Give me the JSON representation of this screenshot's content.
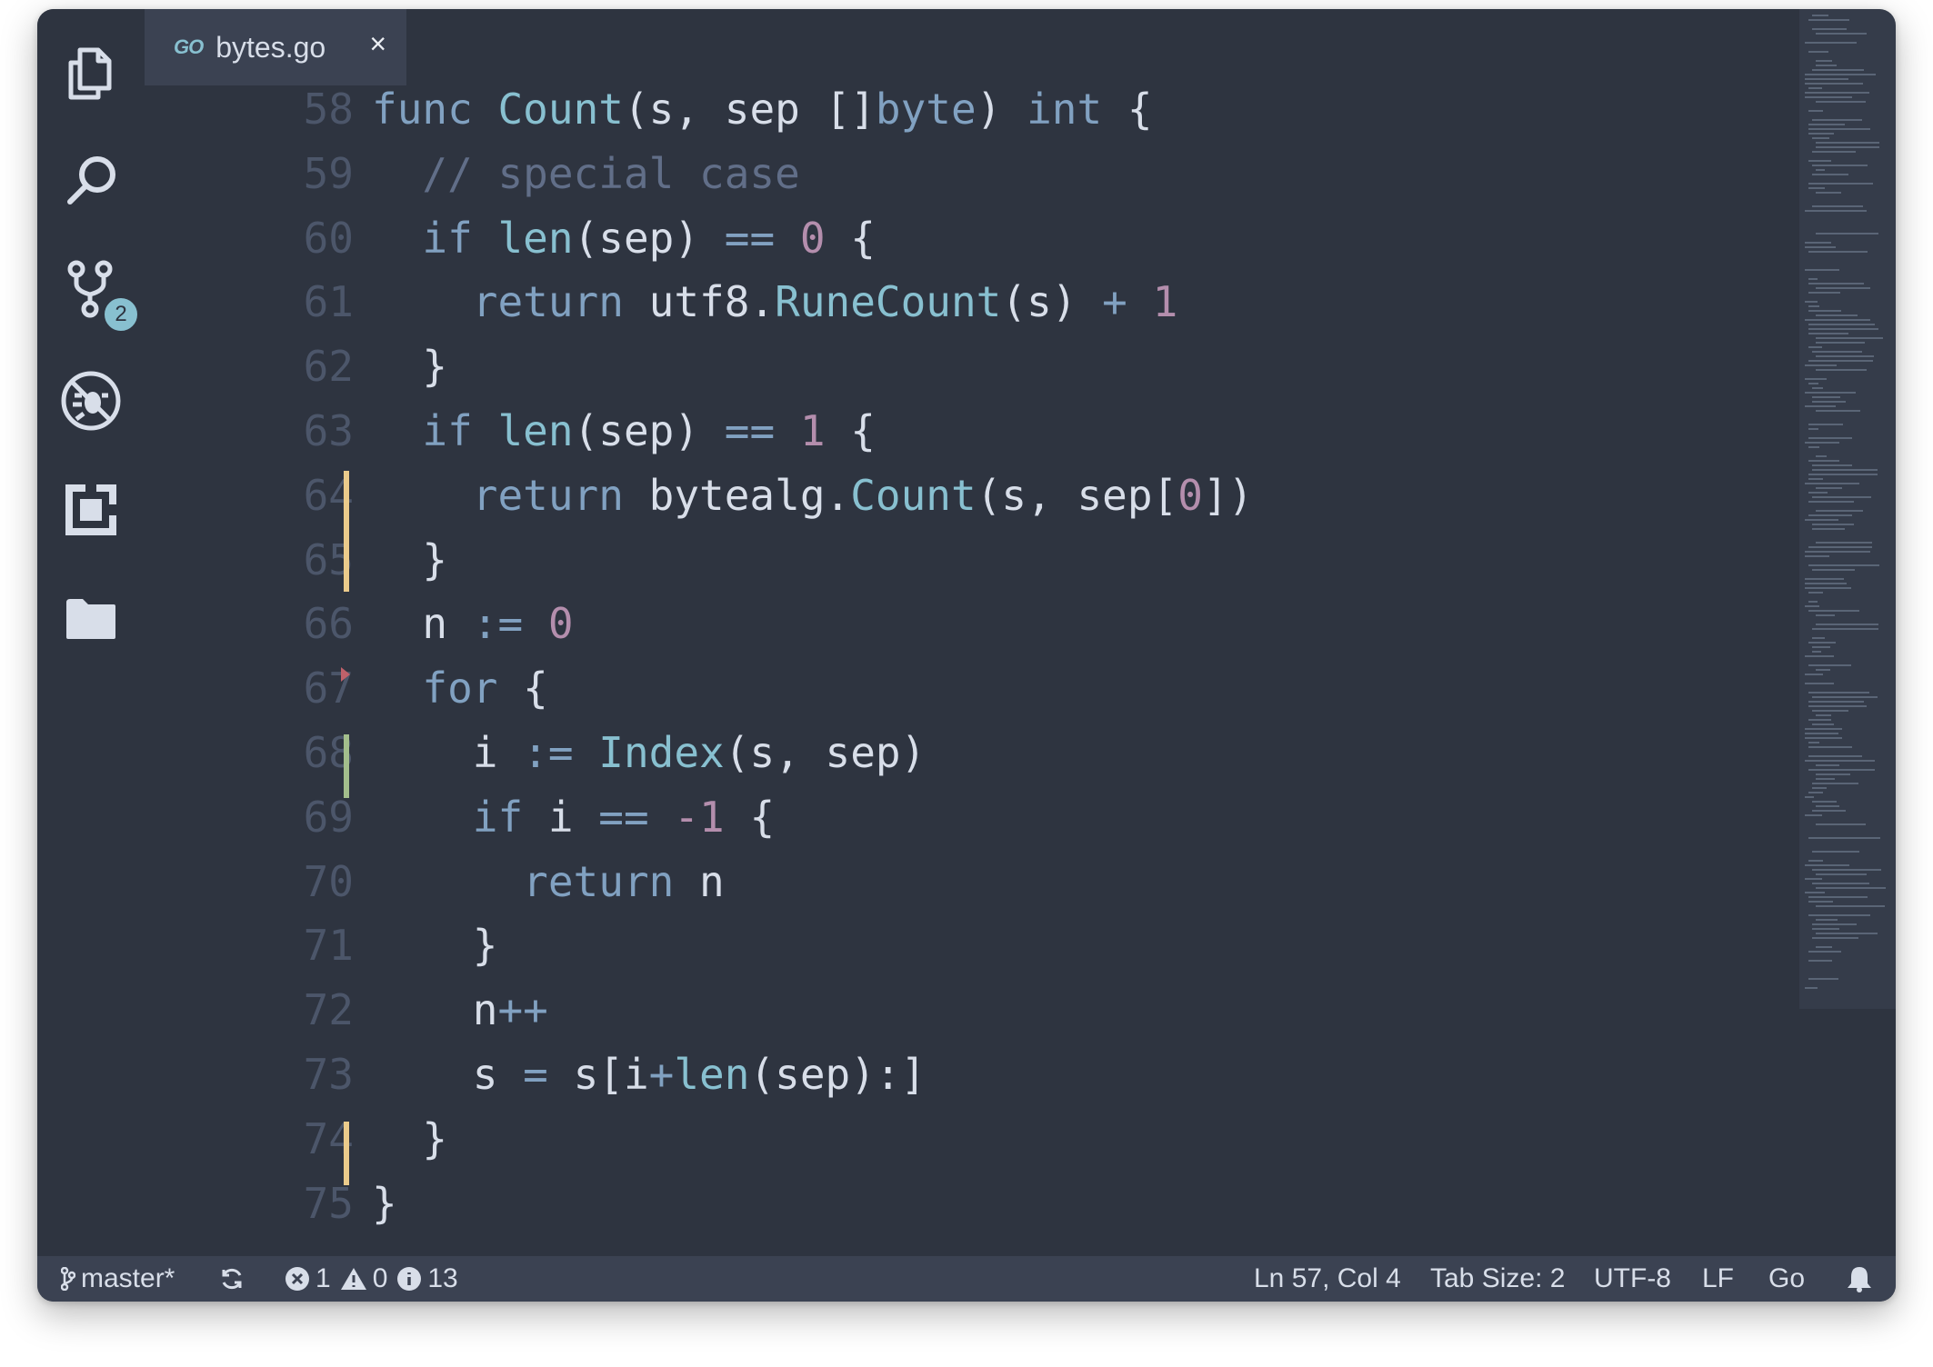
{
  "tab": {
    "icon_text": "GO",
    "filename": "bytes.go",
    "close_glyph": "×"
  },
  "activity_bar": {
    "scm_badge": "2"
  },
  "editor": {
    "lines": [
      {
        "num": "58",
        "code": ""
      },
      {
        "num": "59",
        "code": ""
      },
      {
        "num": "60",
        "code": ""
      },
      {
        "num": "61",
        "code": ""
      },
      {
        "num": "62",
        "code": ""
      },
      {
        "num": "63",
        "code": ""
      },
      {
        "num": "64",
        "code": ""
      },
      {
        "num": "65",
        "code": ""
      },
      {
        "num": "66",
        "code": ""
      },
      {
        "num": "67",
        "code": ""
      },
      {
        "num": "68",
        "code": ""
      },
      {
        "num": "69",
        "code": ""
      },
      {
        "num": "70",
        "code": ""
      },
      {
        "num": "71",
        "code": ""
      },
      {
        "num": "72",
        "code": ""
      },
      {
        "num": "73",
        "code": ""
      },
      {
        "num": "74",
        "code": ""
      },
      {
        "num": "75",
        "code": ""
      }
    ],
    "source": [
      "func Count(s, sep []byte) int {",
      "  // special case",
      "  if len(sep) == 0 {",
      "    return utf8.RuneCount(s) + 1",
      "  }",
      "  if len(sep) == 1 {",
      "    return bytealg.Count(s, sep[0])",
      "  }",
      "  n := 0",
      "  for {",
      "    i := Index(s, sep)",
      "    if i == -1 {",
      "      return n",
      "    }",
      "    n++",
      "    s = s[i+len(sep):]",
      "  }",
      "}"
    ]
  },
  "statusbar": {
    "branch": "master*",
    "errors": "1",
    "warnings": "0",
    "infos": "13",
    "position": "Ln 57, Col 4",
    "tab_size": "Tab Size: 2",
    "encoding": "UTF-8",
    "eol": "LF",
    "language": "Go"
  },
  "colors": {
    "background": "#2e3440",
    "keyword": "#81a1c1",
    "function": "#88c0d0",
    "number": "#b48ead",
    "comment": "#616e88",
    "text": "#d8dee9",
    "modified_gutter": "#ebcb8b",
    "added_gutter": "#a3be8c",
    "badge": "#88c0d0"
  }
}
